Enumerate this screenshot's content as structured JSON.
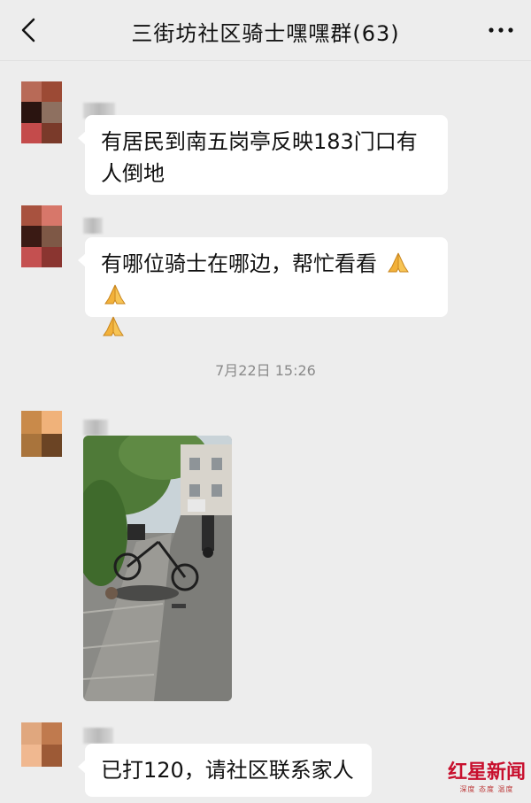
{
  "header": {
    "title": "三街坊社区骑士嘿嘿群(63)",
    "back_icon": "chevron-left-icon",
    "more_icon": "more-dots-icon"
  },
  "messages": [
    {
      "text": "有居民到南五岗亭反映183门口有",
      "text2": "人倒地"
    },
    {
      "text": "有哪位骑士在哪边，帮忙看看",
      "emoji": "folded-hands-emoji"
    },
    {
      "timestamp": "7月22日 15:26"
    },
    {
      "type": "image",
      "description_icon": "photo-image"
    },
    {
      "text": "已打120，请社区联系家人"
    }
  ],
  "watermark": {
    "logo_text": "红星新闻",
    "sub_text": "深度 态度 温度"
  },
  "colors": {
    "background": "#ededed",
    "bubble": "#ffffff",
    "watermark_red": "#c8102e"
  }
}
